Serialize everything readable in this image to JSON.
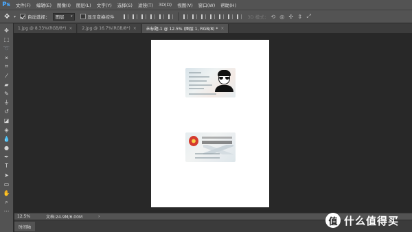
{
  "app": {
    "logo": "Ps"
  },
  "menu": [
    "文件(F)",
    "编辑(E)",
    "图像(I)",
    "图层(L)",
    "文字(Y)",
    "选择(S)",
    "滤镜(T)",
    "3D(D)",
    "视图(V)",
    "窗口(W)",
    "帮助(H)"
  ],
  "options": {
    "auto_select_label": "自动选择：",
    "auto_select_checked": true,
    "auto_select_value": "图层",
    "show_transform_label": "显示变换控件",
    "show_transform_checked": false,
    "mode_3d_label": "3D 模式："
  },
  "tabs": [
    {
      "label": "1.jpg @ 8.33%(RGB/8*)",
      "close": "×",
      "active": false
    },
    {
      "label": "2.jpg @ 16.7%(RGB/8*)",
      "close": "×",
      "active": false
    },
    {
      "label": "未标题-1 @ 12.5% (图层 1, RGB/8) *",
      "close": "×",
      "active": true
    }
  ],
  "status": {
    "zoom": "12.5%",
    "doc_info": "文档:24.9M/6.00M",
    "arrow": "›"
  },
  "timeline": {
    "label": "时间轴"
  },
  "watermark": {
    "logo": "值",
    "text": "什么值得买"
  }
}
